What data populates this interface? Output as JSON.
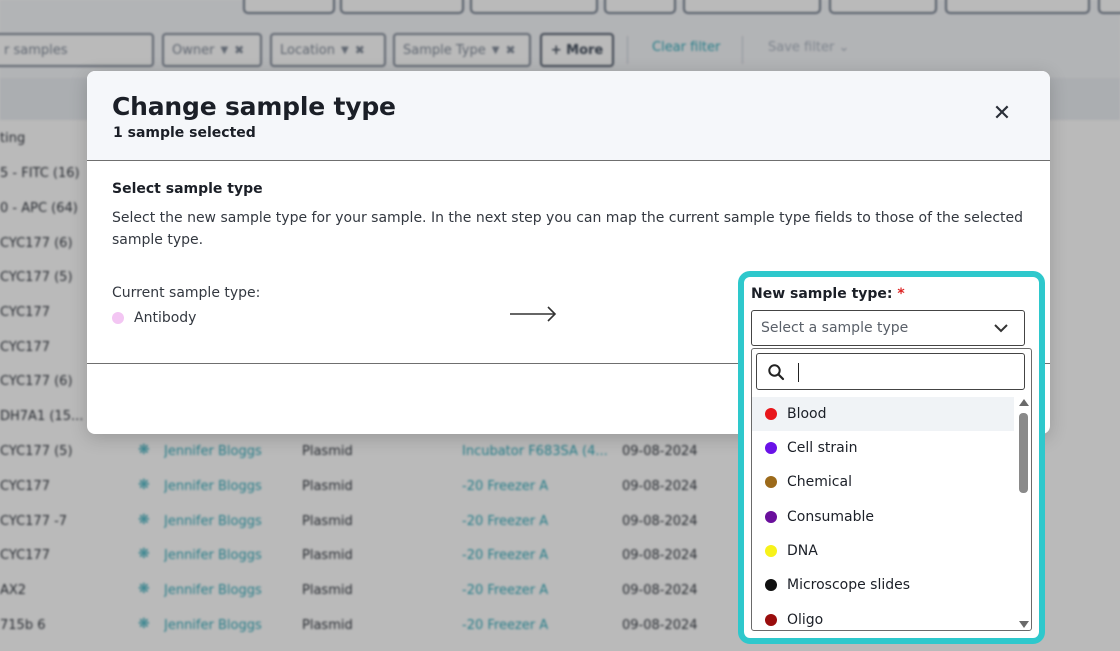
{
  "background": {
    "top_buttons": [
      "",
      "",
      "",
      "",
      "",
      "",
      "",
      ""
    ],
    "filter": {
      "search_placeholder": "r samples",
      "chips": [
        "Owner",
        "Location",
        "Sample Type"
      ],
      "more_label": "+ More",
      "clear_filter": "Clear filter",
      "save_filter": "Save filter"
    },
    "header_text": "ting",
    "rows": [
      {
        "name": "5 - FITC (16)",
        "owner": "",
        "type": "",
        "location": "",
        "date": ""
      },
      {
        "name": "0 - APC (64)",
        "owner": "",
        "type": "",
        "location": "",
        "date": ""
      },
      {
        "name": "CYC177 (6)",
        "owner": "",
        "type": "",
        "location": "",
        "date": ""
      },
      {
        "name": "CYC177 (5)",
        "owner": "",
        "type": "",
        "location": "",
        "date": ""
      },
      {
        "name": "CYC177",
        "owner": "",
        "type": "",
        "location": "",
        "date": ""
      },
      {
        "name": "CYC177",
        "owner": "",
        "type": "",
        "location": "",
        "date": ""
      },
      {
        "name": "CYC177 (6)",
        "owner": "",
        "type": "",
        "location": "",
        "date": ""
      },
      {
        "name": "DH7A1 (15...",
        "owner": "",
        "type": "",
        "location": "",
        "date": ""
      },
      {
        "name": "CYC177 (5)",
        "owner": "Jennifer Bloggs",
        "type": "Plasmid",
        "location": "Incubator F683SA (4...",
        "date": "09-08-2024"
      },
      {
        "name": "CYC177",
        "owner": "Jennifer Bloggs",
        "type": "Plasmid",
        "location": "-20 Freezer A",
        "date": "09-08-2024"
      },
      {
        "name": "CYC177 -7",
        "owner": "Jennifer Bloggs",
        "type": "Plasmid",
        "location": "-20 Freezer A",
        "date": "09-08-2024"
      },
      {
        "name": "CYC177",
        "owner": "Jennifer Bloggs",
        "type": "Plasmid",
        "location": "-20 Freezer A",
        "date": "09-08-2024"
      },
      {
        "name": "AX2",
        "owner": "Jennifer Bloggs",
        "type": "Plasmid",
        "location": "-20 Freezer A",
        "date": "09-08-2024"
      },
      {
        "name": "715b 6",
        "owner": "Jennifer Bloggs",
        "type": "Plasmid",
        "location": "-20 Freezer A",
        "date": "09-08-2024"
      }
    ]
  },
  "modal": {
    "title": "Change sample type",
    "subtitle": "1 sample selected",
    "close_icon": "close-icon",
    "section_title": "Select sample type",
    "description": "Select the new sample type for your sample. In the next step you can map the current sample type fields to those of the selected sample type.",
    "current_label": "Current sample type:",
    "current_value": "Antibody",
    "current_color": "#f3c6f3",
    "arrow_icon": "arrow-right-icon",
    "new_label": "New sample type:",
    "required_mark": "*",
    "select_placeholder": "Select a sample type",
    "search_value": "",
    "options": [
      {
        "label": "Blood",
        "color": "#e8161b"
      },
      {
        "label": "Cell strain",
        "color": "#6a12e8"
      },
      {
        "label": "Chemical",
        "color": "#9c6a1a"
      },
      {
        "label": "Consumable",
        "color": "#6a0f9c"
      },
      {
        "label": "DNA",
        "color": "#f7f21a"
      },
      {
        "label": "Microscope slides",
        "color": "#101010"
      },
      {
        "label": "Oligo",
        "color": "#9a0d0d"
      }
    ]
  },
  "colors": {
    "highlight": "#2ec8cc",
    "link": "#2aa7b8"
  }
}
